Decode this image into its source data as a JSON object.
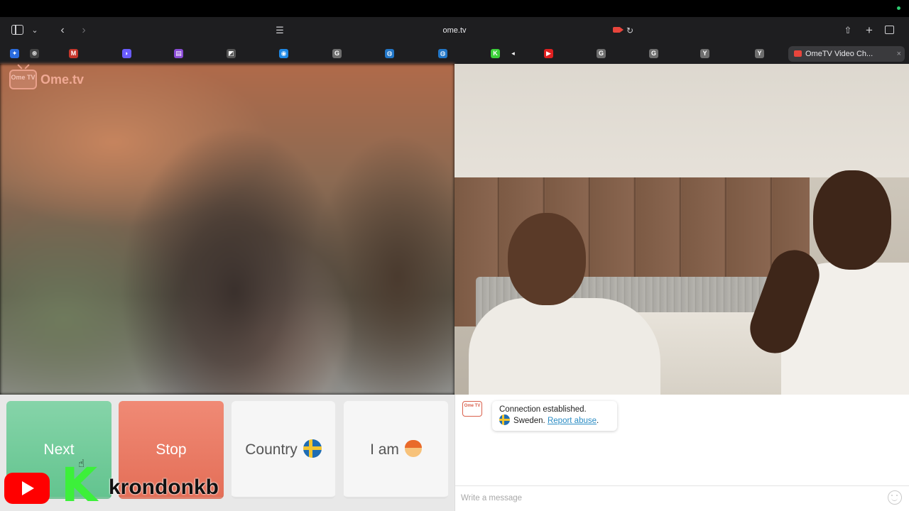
{
  "browser": {
    "url": "ome.tv",
    "active_tab_title": "OmeTV Video Ch...",
    "tab_close_glyph": "×",
    "favicons": [
      {
        "name": "favicon-perplexity",
        "color": "#2b6cdd",
        "glyph": "✦"
      },
      {
        "name": "favicon-openai",
        "color": "#444444",
        "glyph": "⊛"
      },
      {
        "name": "favicon-gmail",
        "color": "#c5362b",
        "glyph": "M"
      },
      {
        "name": "favicon-linear",
        "color": "#6a5cff",
        "glyph": "◗"
      },
      {
        "name": "favicon-purple-app",
        "color": "#8a4bd6",
        "glyph": "▤"
      },
      {
        "name": "favicon-figma",
        "color": "#555555",
        "glyph": "◩"
      },
      {
        "name": "favicon-safari",
        "color": "#1e88e5",
        "glyph": "◉"
      },
      {
        "name": "favicon-grey-g-1",
        "color": "#6e6e6e",
        "glyph": "G"
      },
      {
        "name": "favicon-wifi-1",
        "color": "#2176c7",
        "glyph": "◍"
      },
      {
        "name": "favicon-wifi-2",
        "color": "#2176c7",
        "glyph": "◍"
      },
      {
        "name": "favicon-kick",
        "color": "#3cd13a",
        "glyph": "K"
      },
      {
        "name": "favicon-speaker",
        "color": "#1e1e20",
        "glyph": "◂"
      },
      {
        "name": "favicon-youtube",
        "color": "#e02020",
        "glyph": "▶"
      },
      {
        "name": "favicon-grey-g-2",
        "color": "#6e6e6e",
        "glyph": "G"
      },
      {
        "name": "favicon-grey-g-3",
        "color": "#6e6e6e",
        "glyph": "G"
      },
      {
        "name": "favicon-grey-y-1",
        "color": "#6e6e6e",
        "glyph": "Y"
      },
      {
        "name": "favicon-grey-y-2",
        "color": "#6e6e6e",
        "glyph": "Y"
      }
    ]
  },
  "site": {
    "logo_text": "Ome.tv",
    "logo_badge": "Ome TV"
  },
  "controls": {
    "next_label": "Next",
    "stop_label": "Stop",
    "country_label": "Country",
    "iam_label": "I am",
    "country_flag": "Sweden",
    "next_color": "#63c48f",
    "stop_color": "#e46f58"
  },
  "chat": {
    "bot_badge": "Ome TV",
    "status_message": "Connection established.",
    "country_name": "Sweden.",
    "report_link": "Report abuse",
    "report_suffix": ".",
    "input_placeholder": "Write a message"
  },
  "overlay": {
    "k_letter": "K",
    "channel_name": "krondonkb"
  }
}
